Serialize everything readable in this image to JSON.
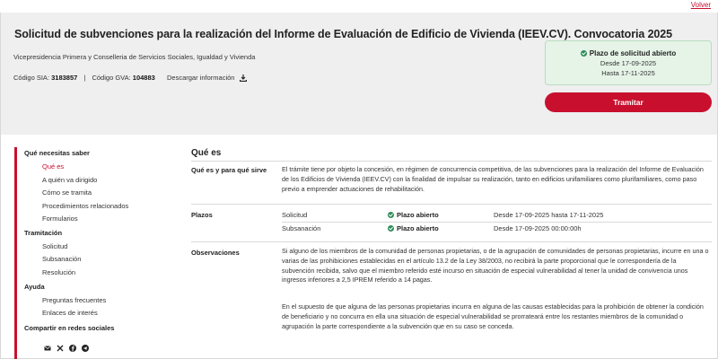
{
  "topbar": {
    "back_label": "Volver"
  },
  "header": {
    "title": "Solicitud de subvenciones para la realización del Informe de Evaluación de Edificio de Vivienda (IEEV.CV). Convocatoria 2025",
    "department": "Vicepresidencia Primera y Conselleria de Servicios Sociales, Igualdad y Vivienda",
    "sia_label": "Código SIA:",
    "sia_value": "3183857",
    "separator": "|",
    "gva_label": "Código GVA:",
    "gva_value": "104883",
    "download_label": "Descargar información"
  },
  "status": {
    "title": "Plazo de solicitud abierto",
    "from": "Desde 17-09-2025",
    "to": "Hasta 17-11-2025",
    "color": "#2e8b57"
  },
  "actions": {
    "tramitar_label": "Tramitar",
    "accent": "#c8102e"
  },
  "sidebar": {
    "sections": [
      {
        "title": "Qué necesitas saber",
        "items": [
          "Qué es",
          "A quién va dirigido",
          "Cómo se tramita",
          "Procedimientos relacionados",
          "Formularios"
        ]
      },
      {
        "title": "Tramitación",
        "items": [
          "Solicitud",
          "Subsanación",
          "Resolución"
        ]
      },
      {
        "title": "Ayuda",
        "items": [
          "Preguntas frecuentes",
          "Enlaces de interés"
        ]
      },
      {
        "title": "Compartir en redes sociales",
        "items": []
      }
    ],
    "active_item": "Qué es",
    "social_icons": [
      "email-icon",
      "x-icon",
      "facebook-icon",
      "telegram-icon"
    ]
  },
  "main": {
    "section_title": "Qué es",
    "que_es": {
      "label": "Qué es y para qué sirve",
      "text": "El trámite tiene por objeto la concesión, en régimen de concurrencia competitiva, de las subvenciones para la realización del Informe de Evaluación de los Edificios de Vivienda (IEEV.CV) con la finalidad de impulsar su realización, tanto en edificios unifamiliares como plurifamiliares, como paso previo a emprender actuaciones de rehabilitación."
    },
    "plazos": {
      "label": "Plazos",
      "rows": [
        {
          "name": "Solicitud",
          "status": "Plazo abierto",
          "dates": "Desde 17-09-2025 hasta 17-11-2025"
        },
        {
          "name": "Subsanación",
          "status": "Plazo abierto",
          "dates": "Desde 17-09-2025 00:00:00h"
        }
      ]
    },
    "observaciones": {
      "label": "Observaciones",
      "p1": "Si alguno de los miembros de la comunidad de personas propietarias, o de la agrupación de comunidades de personas propietarias, incurre en una o varias de las prohibiciones establecidas en el artículo 13.2 de la Ley 38/2003, no recibirá la parte proporcional que le correspondería de la subvención recibida, salvo que el miembro referido esté incurso en situación de especial vulnerabilidad al tener la unidad de convivencia unos ingresos inferiores a 2,5 IPREM referido a 14 pagas.",
      "p2": "En el supuesto de que alguna de las personas propietarias incurra en alguna de las causas establecidas para la prohibición de obtener la condición de beneficiario y no concurra en ella una situación de especial vulnerabilidad se prorrateará entre los restantes miembros de la comunidad o agrupación la parte correspondiente a la subvención que en su caso se conceda."
    }
  }
}
